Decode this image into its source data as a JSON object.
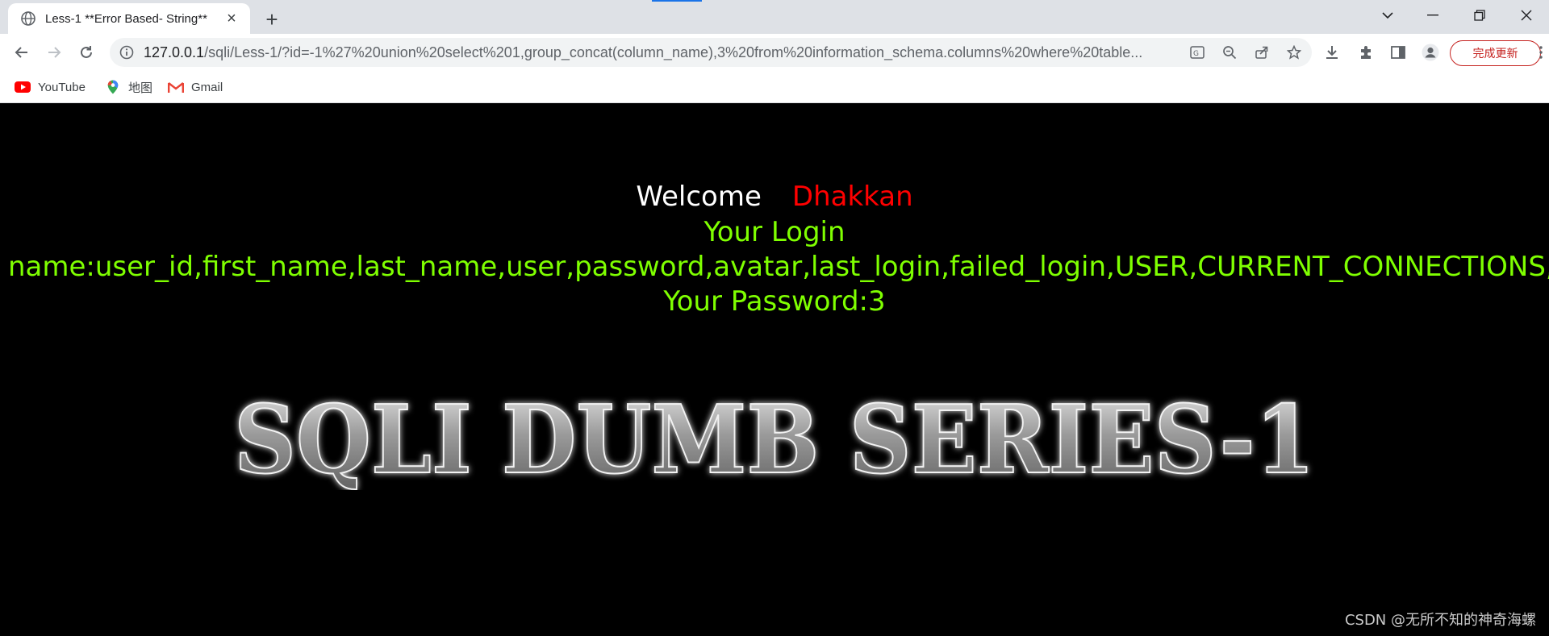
{
  "browser": {
    "tab": {
      "title": "Less-1 **Error Based- String**"
    },
    "address_bar": {
      "url_host": "127.0.0.1",
      "url_rest": "/sqli/Less-1/?id=-1%27%20union%20select%201,group_concat(column_name),3%20from%20information_schema.columns%20where%20table..."
    },
    "update_button": "完成更新",
    "bookmarks": [
      {
        "label": "YouTube",
        "icon": "youtube-icon"
      },
      {
        "label": "地图",
        "icon": "maps-icon"
      },
      {
        "label": "Gmail",
        "icon": "gmail-icon"
      }
    ]
  },
  "page": {
    "welcome_label": "Welcome",
    "welcome_name": "Dhakkan",
    "login_line": "Your Login",
    "name_line": "name:user_id,first_name,last_name,user,password,avatar,last_login,failed_login,USER,CURRENT_CONNECTIONS,TOTAL_CONNECTIONS",
    "password_line": "Your Password:3",
    "banner_text": "SQLI DUMB SERIES-1"
  },
  "watermark": "CSDN @无所不知的神奇海螺",
  "colors": {
    "welcome_name": "#ff0000",
    "result_text": "#7fff00",
    "background": "#000000",
    "update_button": "#c5221f"
  }
}
